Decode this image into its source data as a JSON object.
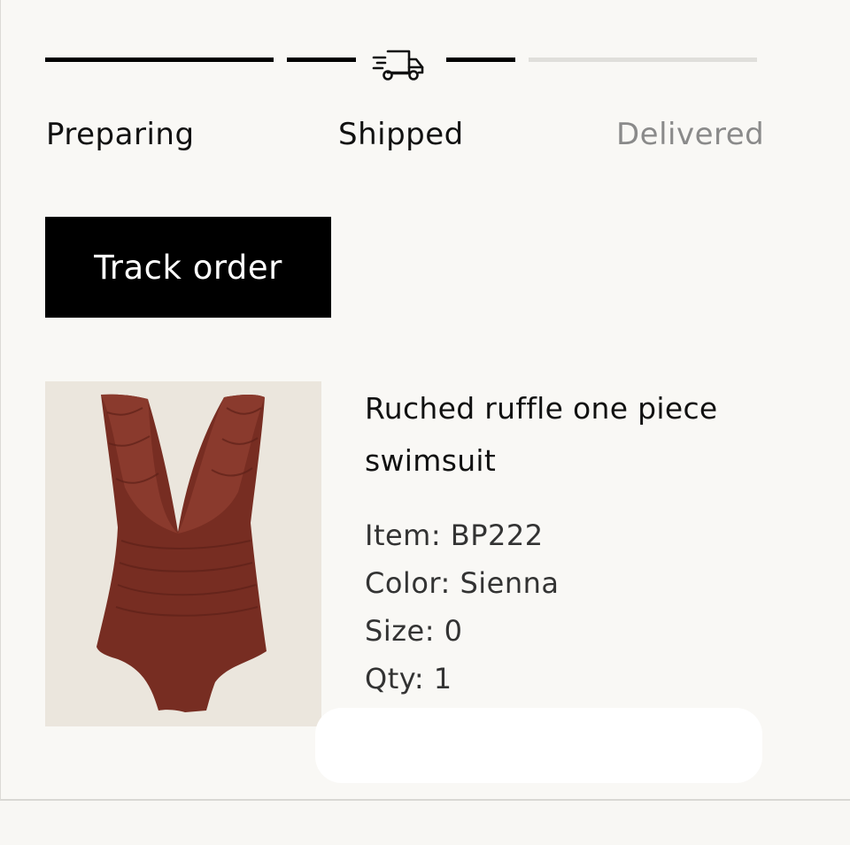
{
  "progress": {
    "steps": [
      {
        "label": "Preparing",
        "state": "complete"
      },
      {
        "label": "Shipped",
        "state": "current"
      },
      {
        "label": "Delivered",
        "state": "pending"
      }
    ],
    "current_icon": "truck-icon",
    "colors": {
      "complete": "#000000",
      "pending": "#e0dfdb",
      "pending_text": "#8a8a8a"
    }
  },
  "actions": {
    "track_label": "Track order"
  },
  "product": {
    "title": "Ruched ruffle one piece swimsuit",
    "image_icon": "swimsuit-image",
    "image_color": "#7a2e23",
    "item": "Item: BP222",
    "color": "Color: Sienna",
    "size": "Size: 0",
    "qty": "Qty: 1"
  }
}
